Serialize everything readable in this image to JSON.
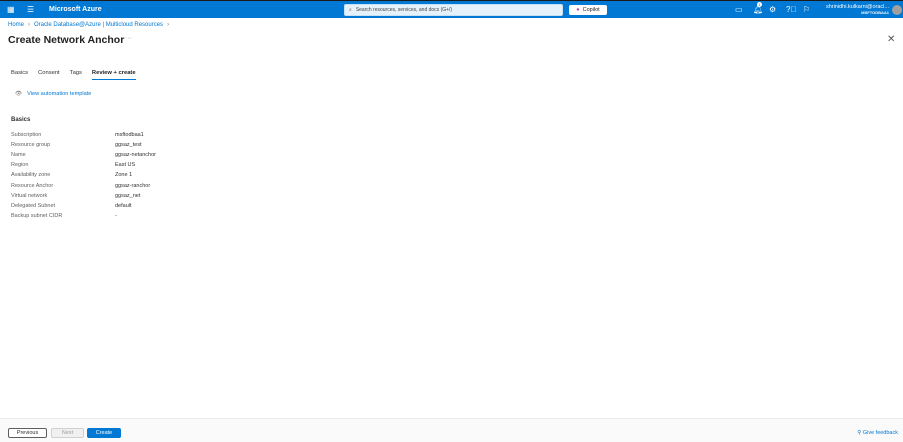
{
  "topbar": {
    "brand": "Microsoft Azure",
    "search_placeholder": "Search resources, services, and docs (G+/)",
    "copilot": "Copilot",
    "notification_count": "1",
    "user_name": "shrinidhi.kulkarni@oracl...",
    "user_directory": "MSFTODBAA1"
  },
  "breadcrumb": [
    "Home",
    "Oracle Database@Azure | Multicloud Resources"
  ],
  "page_title": "Create Network Anchor",
  "tabs": [
    "Basics",
    "Consent",
    "Tags",
    "Review + create"
  ],
  "automation_link": "View automation template",
  "section_title": "Basics",
  "fields": [
    {
      "k": "Subscription",
      "v": "msftodbaa1"
    },
    {
      "k": "Resource group",
      "v": "ggsaz_test"
    },
    {
      "k": "Name",
      "v": "ggsaz-netanchor"
    },
    {
      "k": "Region",
      "v": "East US"
    },
    {
      "k": "Availability zone",
      "v": "Zone 1"
    },
    {
      "k": "Resource Anchor",
      "v": "ggsaz-ranchor"
    },
    {
      "k": "Virtual network",
      "v": "ggsaz_net"
    },
    {
      "k": "Delegated Subnet",
      "v": "default"
    },
    {
      "k": "Backup subnet CIDR",
      "v": "-"
    }
  ],
  "footer": {
    "previous": "Previous",
    "next": "Next",
    "create": "Create",
    "feedback": "Give feedback"
  }
}
